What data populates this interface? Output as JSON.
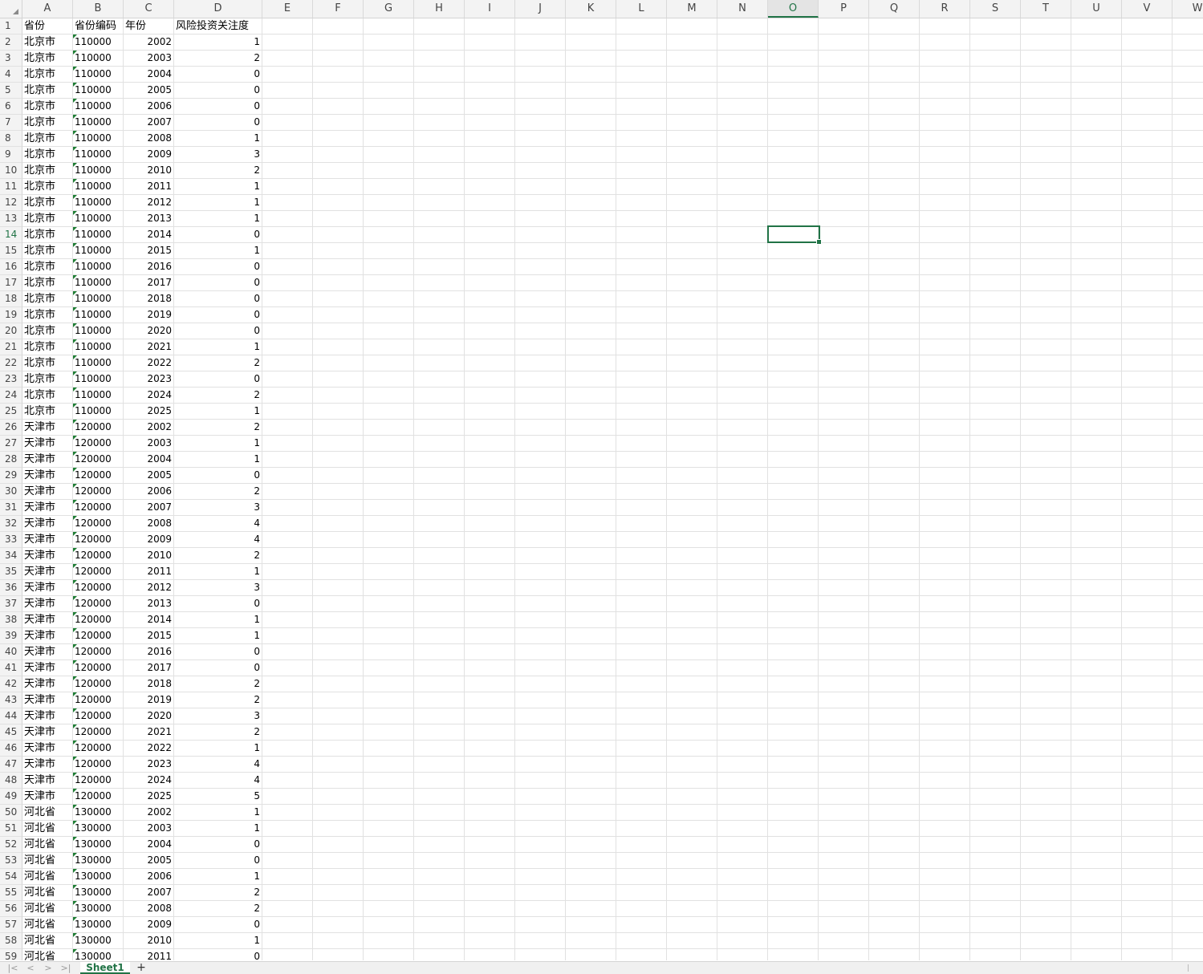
{
  "sheet": {
    "tab_name": "Sheet1",
    "add_sheet_label": "+",
    "nav": [
      "|<",
      "<",
      ">",
      ">|"
    ],
    "selected_cell": "O14",
    "columns": [
      "A",
      "B",
      "C",
      "D",
      "E",
      "F",
      "G",
      "H",
      "I",
      "J",
      "K",
      "L",
      "M",
      "N",
      "O",
      "P",
      "Q",
      "R",
      "S",
      "T",
      "U",
      "V",
      "W"
    ],
    "header_row": [
      "省份",
      "省份编码",
      "年份",
      "风险投资关注度"
    ],
    "rows": [
      [
        "北京市",
        "110000",
        "2002",
        "1"
      ],
      [
        "北京市",
        "110000",
        "2003",
        "2"
      ],
      [
        "北京市",
        "110000",
        "2004",
        "0"
      ],
      [
        "北京市",
        "110000",
        "2005",
        "0"
      ],
      [
        "北京市",
        "110000",
        "2006",
        "0"
      ],
      [
        "北京市",
        "110000",
        "2007",
        "0"
      ],
      [
        "北京市",
        "110000",
        "2008",
        "1"
      ],
      [
        "北京市",
        "110000",
        "2009",
        "3"
      ],
      [
        "北京市",
        "110000",
        "2010",
        "2"
      ],
      [
        "北京市",
        "110000",
        "2011",
        "1"
      ],
      [
        "北京市",
        "110000",
        "2012",
        "1"
      ],
      [
        "北京市",
        "110000",
        "2013",
        "1"
      ],
      [
        "北京市",
        "110000",
        "2014",
        "0"
      ],
      [
        "北京市",
        "110000",
        "2015",
        "1"
      ],
      [
        "北京市",
        "110000",
        "2016",
        "0"
      ],
      [
        "北京市",
        "110000",
        "2017",
        "0"
      ],
      [
        "北京市",
        "110000",
        "2018",
        "0"
      ],
      [
        "北京市",
        "110000",
        "2019",
        "0"
      ],
      [
        "北京市",
        "110000",
        "2020",
        "0"
      ],
      [
        "北京市",
        "110000",
        "2021",
        "1"
      ],
      [
        "北京市",
        "110000",
        "2022",
        "2"
      ],
      [
        "北京市",
        "110000",
        "2023",
        "0"
      ],
      [
        "北京市",
        "110000",
        "2024",
        "2"
      ],
      [
        "北京市",
        "110000",
        "2025",
        "1"
      ],
      [
        "天津市",
        "120000",
        "2002",
        "2"
      ],
      [
        "天津市",
        "120000",
        "2003",
        "1"
      ],
      [
        "天津市",
        "120000",
        "2004",
        "1"
      ],
      [
        "天津市",
        "120000",
        "2005",
        "0"
      ],
      [
        "天津市",
        "120000",
        "2006",
        "2"
      ],
      [
        "天津市",
        "120000",
        "2007",
        "3"
      ],
      [
        "天津市",
        "120000",
        "2008",
        "4"
      ],
      [
        "天津市",
        "120000",
        "2009",
        "4"
      ],
      [
        "天津市",
        "120000",
        "2010",
        "2"
      ],
      [
        "天津市",
        "120000",
        "2011",
        "1"
      ],
      [
        "天津市",
        "120000",
        "2012",
        "3"
      ],
      [
        "天津市",
        "120000",
        "2013",
        "0"
      ],
      [
        "天津市",
        "120000",
        "2014",
        "1"
      ],
      [
        "天津市",
        "120000",
        "2015",
        "1"
      ],
      [
        "天津市",
        "120000",
        "2016",
        "0"
      ],
      [
        "天津市",
        "120000",
        "2017",
        "0"
      ],
      [
        "天津市",
        "120000",
        "2018",
        "2"
      ],
      [
        "天津市",
        "120000",
        "2019",
        "2"
      ],
      [
        "天津市",
        "120000",
        "2020",
        "3"
      ],
      [
        "天津市",
        "120000",
        "2021",
        "2"
      ],
      [
        "天津市",
        "120000",
        "2022",
        "1"
      ],
      [
        "天津市",
        "120000",
        "2023",
        "4"
      ],
      [
        "天津市",
        "120000",
        "2024",
        "4"
      ],
      [
        "天津市",
        "120000",
        "2025",
        "5"
      ],
      [
        "河北省",
        "130000",
        "2002",
        "1"
      ],
      [
        "河北省",
        "130000",
        "2003",
        "1"
      ],
      [
        "河北省",
        "130000",
        "2004",
        "0"
      ],
      [
        "河北省",
        "130000",
        "2005",
        "0"
      ],
      [
        "河北省",
        "130000",
        "2006",
        "1"
      ],
      [
        "河北省",
        "130000",
        "2007",
        "2"
      ],
      [
        "河北省",
        "130000",
        "2008",
        "2"
      ],
      [
        "河北省",
        "130000",
        "2009",
        "0"
      ],
      [
        "河北省",
        "130000",
        "2010",
        "1"
      ],
      [
        "河北省",
        "130000",
        "2011",
        "0"
      ]
    ],
    "colors": {
      "accent": "#217346",
      "header_bg": "#f3f3f3",
      "gridline": "#e1e1e1",
      "text_indicator": "#1e7e34"
    }
  }
}
